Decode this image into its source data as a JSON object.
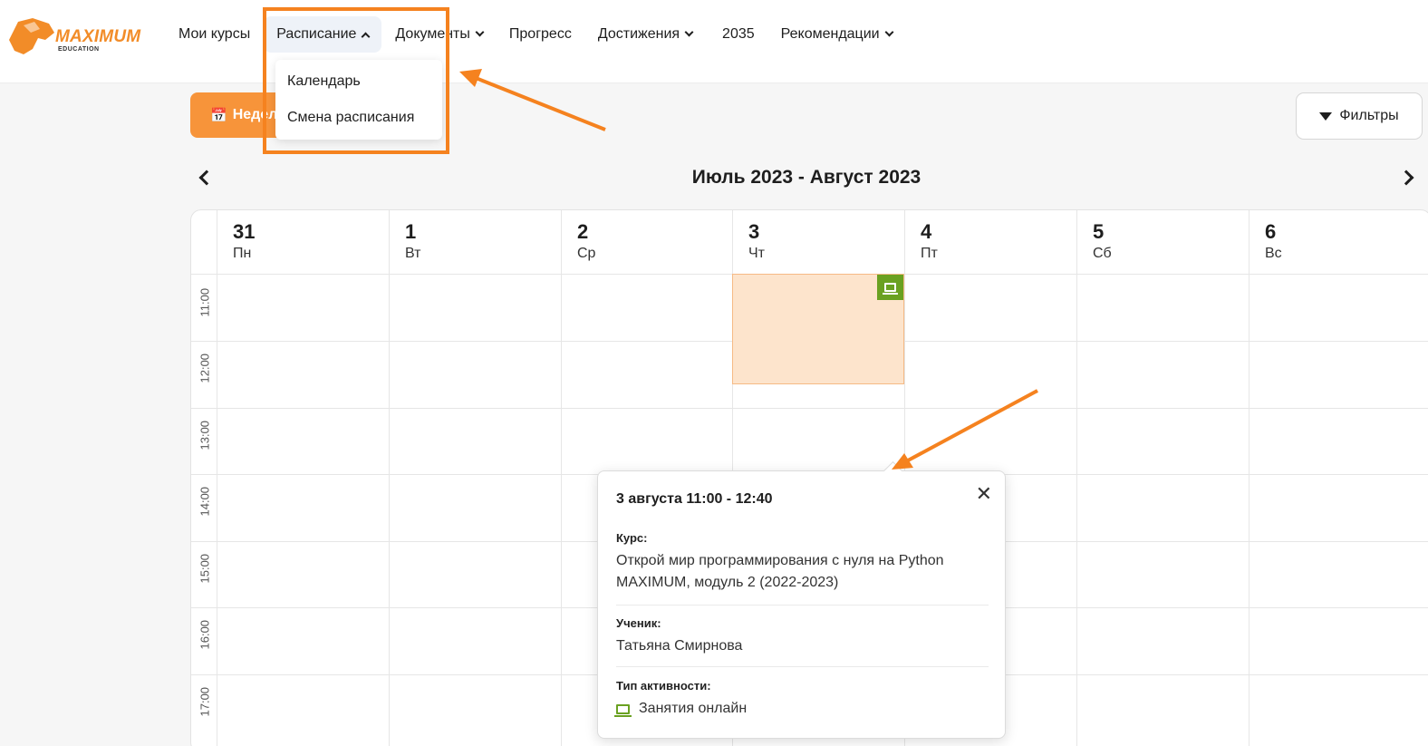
{
  "brand": {
    "name": "MAXIMUM",
    "sub": "EDUCATION",
    "accent": "#f28c28"
  },
  "nav": {
    "items": [
      {
        "label": "Мои курсы"
      },
      {
        "label": "Расписание"
      },
      {
        "label": "Документы"
      },
      {
        "label": "Прогресс"
      },
      {
        "label": "Достижения"
      },
      {
        "label": "2035"
      },
      {
        "label": "Рекомендации"
      }
    ]
  },
  "dropdown": {
    "items": [
      {
        "label": "Календарь"
      },
      {
        "label": "Смена расписания"
      }
    ]
  },
  "toolbar": {
    "week_label": "Недел",
    "filters_label": "Фильтры"
  },
  "calendar": {
    "title": "Июль 2023 - Август 2023",
    "days": [
      {
        "num": "31",
        "name": "Пн"
      },
      {
        "num": "1",
        "name": "Вт"
      },
      {
        "num": "2",
        "name": "Ср"
      },
      {
        "num": "3",
        "name": "Чт"
      },
      {
        "num": "4",
        "name": "Пт"
      },
      {
        "num": "5",
        "name": "Сб"
      },
      {
        "num": "6",
        "name": "Вс"
      }
    ],
    "times": [
      "11:00",
      "12:00",
      "13:00",
      "14:00",
      "15:00",
      "16:00",
      "17:00"
    ]
  },
  "event_popup": {
    "title": "3 августа 11:00 - 12:40",
    "course_label": "Курс:",
    "course_value": "Открой мир программирования с нуля на Python MAXIMUM, модуль 2 (2022-2023)",
    "student_label": "Ученик:",
    "student_value": "Татьяна Смирнова",
    "activity_label": "Тип активности:",
    "activity_value": "Занятия онлайн",
    "close": "✕"
  },
  "colors": {
    "highlight": "#f5821f",
    "event_bg": "#fde4cc",
    "online_green": "#6aa121",
    "week_button": "#f7943a"
  }
}
